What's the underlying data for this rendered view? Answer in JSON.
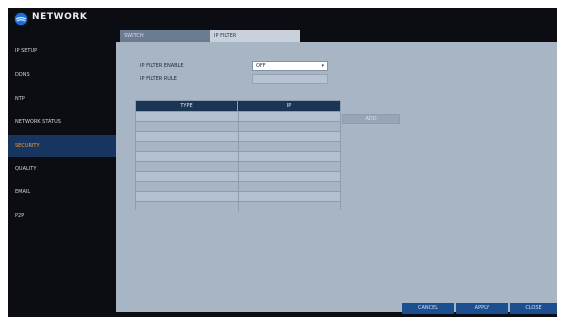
{
  "window": {
    "title": "NETWORK",
    "logo_icon": "network-globe-icon"
  },
  "sidebar": {
    "items": [
      {
        "label": "IP SETUP",
        "active": false
      },
      {
        "label": "DDNS",
        "active": false
      },
      {
        "label": "NTP",
        "active": false
      },
      {
        "label": "NETWORK STATUS",
        "active": false
      },
      {
        "label": "SECURITY",
        "active": true
      },
      {
        "label": "QUALITY",
        "active": false
      },
      {
        "label": "EMAIL",
        "active": false
      },
      {
        "label": "P2P",
        "active": false
      }
    ]
  },
  "tabs": [
    {
      "label": "SWITCH",
      "active": false
    },
    {
      "label": "IP FILTER",
      "active": true
    }
  ],
  "form": {
    "ip_filter_enable_label": "IP FILTER ENABLE",
    "ip_filter_enable_value": "OFF",
    "ip_filter_rule_label": "IP FILTER RULE",
    "ip_filter_rule_value": ""
  },
  "table": {
    "columns": [
      "TYPE",
      "IP"
    ],
    "rows": []
  },
  "buttons": {
    "add": "ADD",
    "cancel": "CANCEL",
    "apply": "APPLY",
    "close": "CLOSE"
  },
  "colors": {
    "sidebar_active_bg": "#17355e",
    "sidebar_active_text": "#f0a23a",
    "content_bg": "#a7b5c5",
    "table_header_bg": "#1b3555",
    "button_blue": "#1b4f8f"
  }
}
